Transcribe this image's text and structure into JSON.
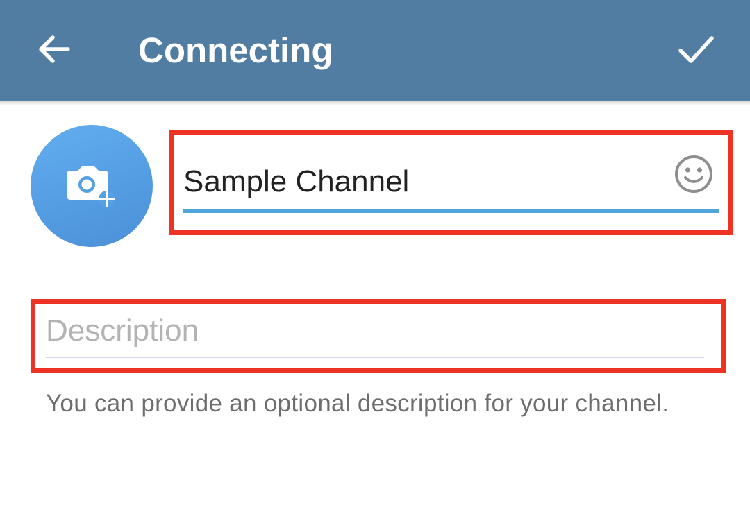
{
  "header": {
    "title": "Connecting",
    "back_icon": "arrow-left-icon",
    "done_icon": "check-icon",
    "background_color": "#517da2"
  },
  "channel": {
    "photo_icon": "camera-add-icon",
    "name_value": "Sample Channel",
    "emoji_icon": "smile-icon",
    "description_placeholder": "Description",
    "description_value": "",
    "helper_text": "You can provide an optional description for your channel."
  },
  "colors": {
    "accent_underline": "#4ea6d9",
    "highlight_border": "#ee3224",
    "avatar_gradient_start": "#62adf0",
    "avatar_gradient_end": "#4a90d8"
  }
}
